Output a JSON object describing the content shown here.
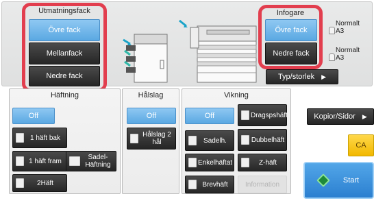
{
  "output_tray": {
    "title": "Utmatningsfack",
    "options": [
      {
        "label": "Övre fack",
        "selected": true
      },
      {
        "label": "Mellanfack",
        "selected": false
      },
      {
        "label": "Nedre fack",
        "selected": false
      }
    ]
  },
  "input_tray": {
    "title": "Infogare",
    "options": [
      {
        "label": "Övre fack",
        "selected": true,
        "paper_type": "Normalt",
        "paper_size": "A3"
      },
      {
        "label": "Nedre fack",
        "selected": false,
        "paper_type": "Normalt",
        "paper_size": "A3"
      }
    ]
  },
  "type_size_button": {
    "label": "Typ/storlek"
  },
  "stapling": {
    "title": "Häftning",
    "off_label": "Off",
    "options": [
      {
        "label": "1 häft bak",
        "icon": "staple-back-corner-icon"
      },
      {
        "label": "1 häft fram",
        "icon": "staple-front-corner-icon"
      },
      {
        "label": "Sadel-Häftning",
        "icon": "saddle-stitch-booklet-icon"
      },
      {
        "label": "2Häft",
        "icon": "staple-two-icon"
      }
    ]
  },
  "punch": {
    "title": "Hålslag",
    "off_label": "Off",
    "options": [
      {
        "label": "Hålslag 2 hål",
        "icon": "punch-holes-icon"
      }
    ]
  },
  "folding": {
    "title": "Vikning",
    "off_label": "Off",
    "options": [
      {
        "label": "Dragspshäft",
        "icon": "accordion-fold-icon"
      },
      {
        "label": "Sadelh.",
        "icon": "saddle-fold-icon"
      },
      {
        "label": "Dubbelhäft",
        "icon": "double-fold-icon"
      },
      {
        "label": "Enkelhäftat",
        "icon": "half-fold-icon"
      },
      {
        "label": "Z-häft",
        "icon": "z-fold-icon"
      },
      {
        "label": "Brevhäft",
        "icon": "letter-fold-icon"
      },
      {
        "label": "Information",
        "disabled": true
      }
    ]
  },
  "copies_button": {
    "label": "Kopior/Sidor"
  },
  "ca_button": {
    "label": "CA"
  },
  "start_button": {
    "label": "Start"
  },
  "colors": {
    "highlight_border": "#e23e4e",
    "selected_blue": "#5aa8e2",
    "dark_button": "#2c2c2c",
    "ca_yellow": "#f2b800",
    "start_blue": "#2b7fd0"
  }
}
